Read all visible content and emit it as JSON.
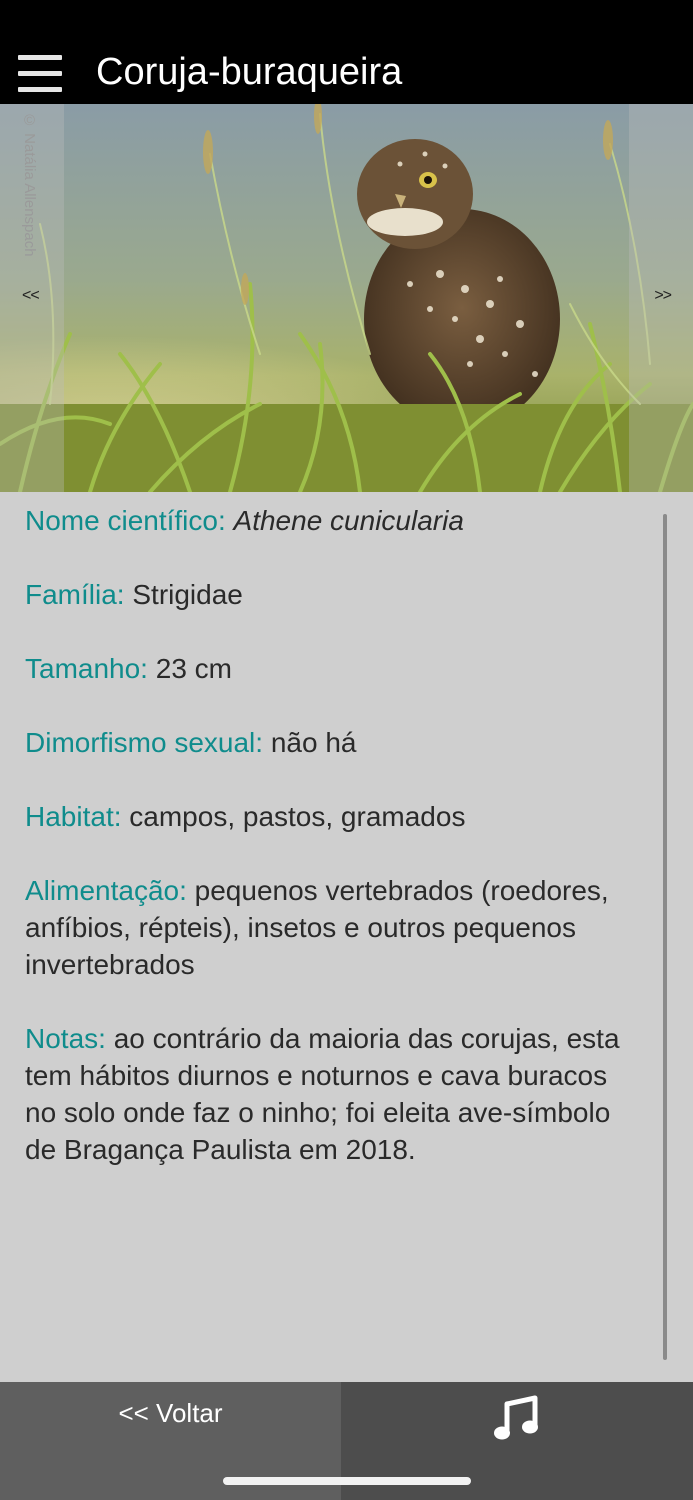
{
  "header": {
    "title": "Coruja-buraqueira",
    "menu_icon": "hamburger-menu-icon"
  },
  "photo": {
    "credit": "© Natália Allenspach",
    "prev_label": "<<",
    "next_label": ">>"
  },
  "info": {
    "scientific_name": {
      "label": "Nome científico:",
      "value": "Athene cunicularia"
    },
    "family": {
      "label": "Família:",
      "value": "Strigidae"
    },
    "size": {
      "label": "Tamanho:",
      "value": "23 cm"
    },
    "dimorphism": {
      "label": "Dimorfismo sexual:",
      "value": "não há"
    },
    "habitat": {
      "label": "Habitat:",
      "value": "campos, pastos, gramados"
    },
    "diet": {
      "label": "Alimentação:",
      "value": "pequenos vertebrados (roedores, anfíbios, répteis), insetos e outros pequenos invertebrados"
    },
    "notes": {
      "label": "Notas:",
      "value": "ao contrário da maioria das corujas, esta tem hábitos diurnos e noturnos e cava buracos no solo onde faz o ninho; foi eleita ave-símbolo de Bragança Paulista em 2018."
    }
  },
  "bottom_bar": {
    "back_label": "<< Voltar",
    "sound_icon": "music-note-icon"
  },
  "colors": {
    "header_bg": "#000000",
    "label_teal": "#0f8c8c",
    "content_bg": "#cfcfcf",
    "bottom_bar_bg": "#5f5f5f"
  }
}
